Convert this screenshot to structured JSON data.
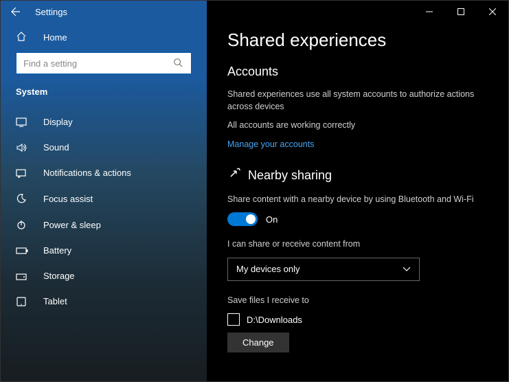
{
  "titlebar": {
    "title": "Settings"
  },
  "sidebar": {
    "home": "Home",
    "search_placeholder": "Find a setting",
    "section": "System",
    "items": [
      {
        "label": "Display"
      },
      {
        "label": "Sound"
      },
      {
        "label": "Notifications & actions"
      },
      {
        "label": "Focus assist"
      },
      {
        "label": "Power & sleep"
      },
      {
        "label": "Battery"
      },
      {
        "label": "Storage"
      },
      {
        "label": "Tablet"
      }
    ]
  },
  "page": {
    "title": "Shared experiences",
    "accounts": {
      "heading": "Accounts",
      "desc": "Shared experiences use all system accounts to authorize actions across devices",
      "status": "All accounts are working correctly",
      "link": "Manage your accounts"
    },
    "nearby": {
      "heading": "Nearby sharing",
      "desc": "Share content with a nearby device by using Bluetooth and Wi-Fi",
      "toggle_label": "On",
      "share_label": "I can share or receive content from",
      "dropdown_value": "My devices only",
      "save_label": "Save files I receive to",
      "save_path": "D:\\Downloads",
      "change_btn": "Change"
    }
  }
}
